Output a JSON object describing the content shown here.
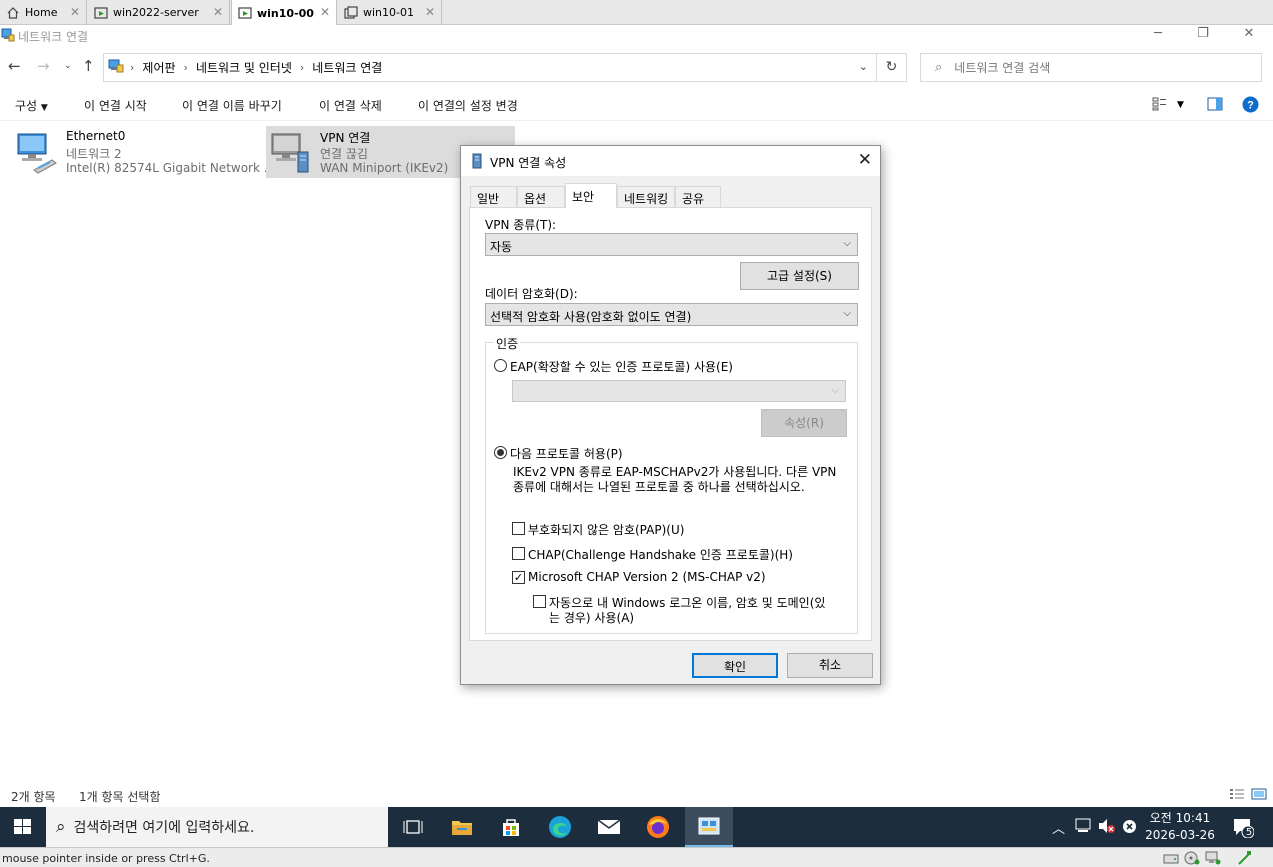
{
  "vm_tabs": [
    {
      "label": "Home",
      "icon": "home-icon",
      "active": false
    },
    {
      "label": "win2022-server",
      "icon": "vm-running-icon",
      "active": false
    },
    {
      "label": "win10-00",
      "icon": "vm-running-icon",
      "active": true
    },
    {
      "label": "win10-01",
      "icon": "vm-icon",
      "active": false
    }
  ],
  "window": {
    "title": "네트워크 연결",
    "breadcrumb": [
      "제어판",
      "네트워크 및 인터넷",
      "네트워크 연결"
    ],
    "search_placeholder": "네트워크 연결 검색"
  },
  "commands": [
    "구성",
    "이 연결 시작",
    "이 연결 이름 바꾸기",
    "이 연결 삭제",
    "이 연결의 설정 변경"
  ],
  "connections": [
    {
      "name": "Ethernet0",
      "status": "네트워크 2",
      "device": "Intel(R) 82574L Gigabit Network ...",
      "selected": false
    },
    {
      "name": "VPN 연결",
      "status": "연결 끊김",
      "device": "WAN Miniport (IKEv2)",
      "selected": true
    }
  ],
  "status_bar": {
    "count": "2개 항목",
    "selected": "1개 항목 선택함"
  },
  "dialog": {
    "title": "VPN 연결 속성",
    "tabs": [
      "일반",
      "옵션",
      "보안",
      "네트워킹",
      "공유"
    ],
    "active_tab": "보안",
    "vpn_type_label": "VPN 종류(T):",
    "vpn_type_value": "자동",
    "advanced_button": "고급 설정(S)",
    "encryption_label": "데이터 암호화(D):",
    "encryption_value": "선택적 암호화 사용(암호화 없이도 연결)",
    "auth_group": "인증",
    "eap_radio": "EAP(확장할 수 있는 인증 프로토콜) 사용(E)",
    "eap_radio_checked": false,
    "eap_properties_button": "속성(R)",
    "allow_radio": "다음 프로토콜 허용(P)",
    "allow_radio_checked": true,
    "allow_note_line1": "IKEv2 VPN 종류로 EAP-MSCHAPv2가 사용됩니다. 다른 VPN",
    "allow_note_line2": "종류에 대해서는 나열된 프로토콜 중 하나를 선택하십시오.",
    "checkboxes": [
      {
        "label": "부호화되지 않은 암호(PAP)(U)",
        "checked": false
      },
      {
        "label": "CHAP(Challenge Handshake 인증 프로토콜)(H)",
        "checked": false
      },
      {
        "label": "Microsoft CHAP Version 2 (MS-CHAP v2)",
        "checked": true
      }
    ],
    "auto_logon_line1": "자동으로 내 Windows 로그온 이름, 암호 및 도메인(있",
    "auto_logon_line2": "는 경우) 사용(A)",
    "auto_logon_checked": false,
    "ok_button": "확인",
    "cancel_button": "취소"
  },
  "taskbar": {
    "search_placeholder": "검색하려면 여기에 입력하세요.",
    "time": "오전 10:41",
    "date": "2026-03-26",
    "notification_count": "5"
  },
  "vm_status": "mouse pointer inside or press Ctrl+G."
}
